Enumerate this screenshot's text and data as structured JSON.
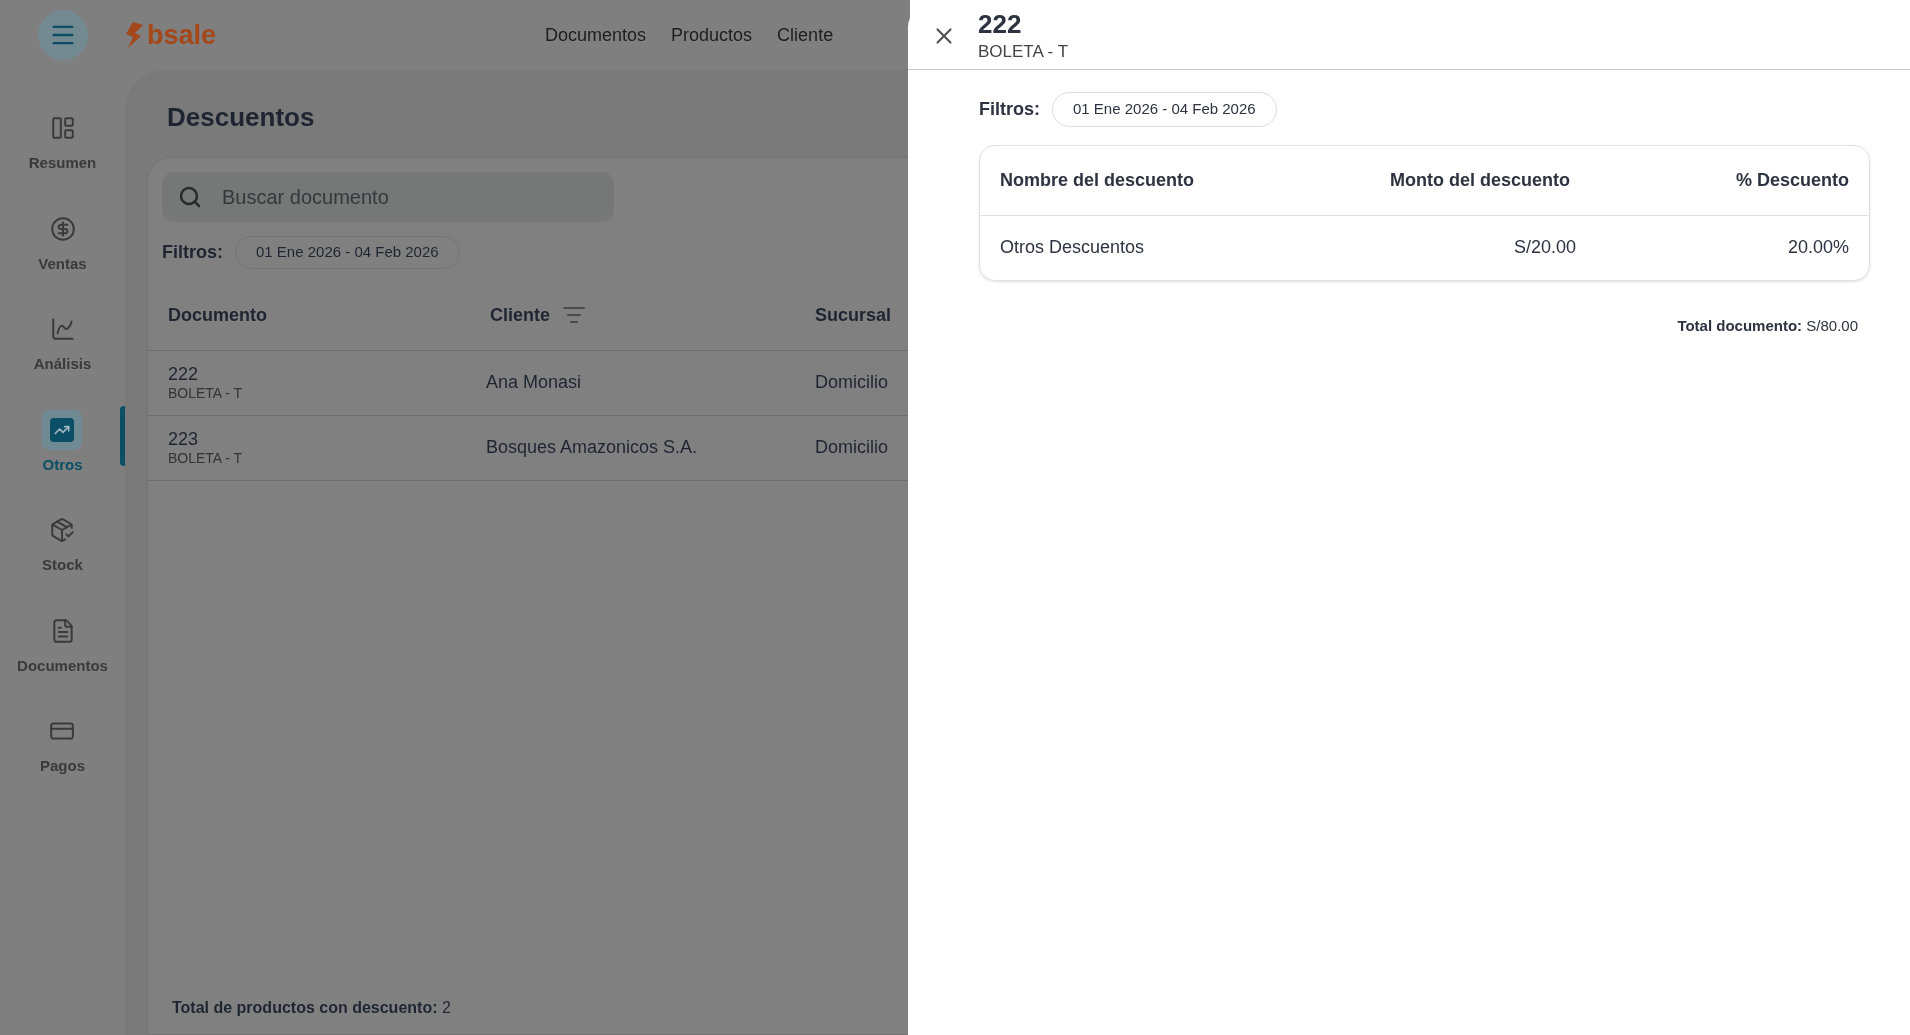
{
  "header": {
    "logo": "bsale",
    "nav": [
      "Documentos",
      "Productos",
      "Cliente"
    ]
  },
  "sidebar": {
    "items": [
      {
        "label": "Resumen",
        "selected": false
      },
      {
        "label": "Ventas",
        "selected": false
      },
      {
        "label": "Análisis",
        "selected": false
      },
      {
        "label": "Otros",
        "selected": true
      },
      {
        "label": "Stock",
        "selected": false
      },
      {
        "label": "Documentos",
        "selected": false
      },
      {
        "label": "Pagos",
        "selected": false
      }
    ]
  },
  "page": {
    "title": "Descuentos",
    "search": {
      "placeholder": "Buscar documento"
    },
    "filters_label": "Filtros:",
    "filter_chip": "01 Ene 2026 - 04 Feb 2026",
    "table": {
      "columns": [
        {
          "label": "Documento",
          "sortable": false
        },
        {
          "label": "Cliente",
          "sortable": true
        },
        {
          "label": "Sucursal",
          "sortable": false
        }
      ],
      "rows": [
        {
          "document": "222",
          "type": "BOLETA - T",
          "client": "Ana Monasi",
          "branch": "Domicilio"
        },
        {
          "document": "223",
          "type": "BOLETA - T",
          "client": "Bosques Amazonicos S.A.",
          "branch": "Domicilio"
        }
      ]
    },
    "footer": {
      "label": "Total de productos con descuento:",
      "value": "2"
    }
  },
  "drawer": {
    "title": "222",
    "subtitle": "BOLETA - T",
    "filters_label": "Filtros:",
    "filter_chip": "01 Ene 2026 - 04 Feb 2026",
    "table": {
      "columns": [
        "Nombre del descuento",
        "Monto del descuento",
        "% Descuento"
      ],
      "rows": [
        [
          "Otros Descuentos",
          "S/20.00",
          "20.00%"
        ]
      ]
    },
    "total": {
      "label": "Total documento:",
      "value": "S/80.00"
    }
  }
}
